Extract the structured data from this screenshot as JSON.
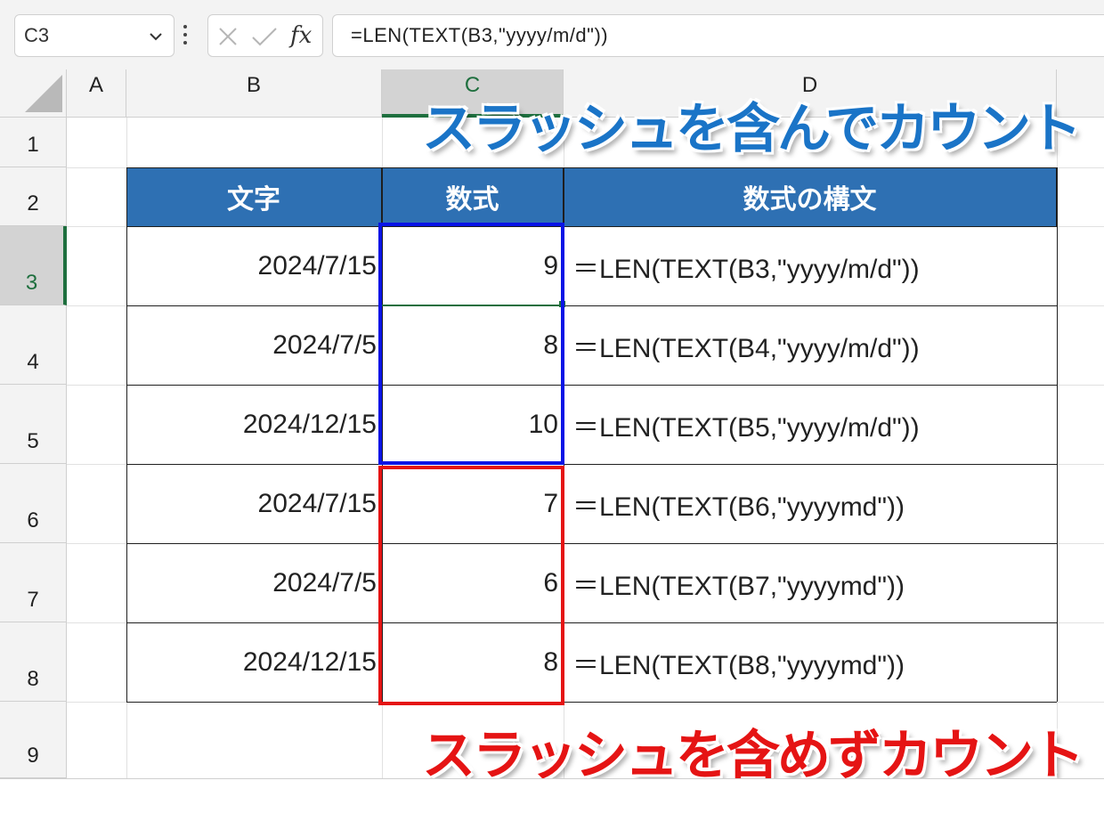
{
  "formula_bar": {
    "name_box": "C3",
    "fx_label": "fx",
    "formula": "=LEN(TEXT(B3,\"yyyy/m/d\"))"
  },
  "columns": [
    "A",
    "B",
    "C",
    "D"
  ],
  "rows": [
    "1",
    "2",
    "3",
    "4",
    "5",
    "6",
    "7",
    "8",
    "9"
  ],
  "table": {
    "headers": [
      "文字",
      "数式",
      "数式の構文"
    ],
    "rows": [
      {
        "text": "2024/7/15",
        "result": "9",
        "formula": "＝LEN(TEXT(B3,\"yyyy/m/d\"))"
      },
      {
        "text": "2024/7/5",
        "result": "8",
        "formula": "＝LEN(TEXT(B4,\"yyyy/m/d\"))"
      },
      {
        "text": "2024/12/15",
        "result": "10",
        "formula": "＝LEN(TEXT(B5,\"yyyy/m/d\"))"
      },
      {
        "text": "2024/7/15",
        "result": "7",
        "formula": "＝LEN(TEXT(B6,\"yyyymd\"))"
      },
      {
        "text": "2024/7/5",
        "result": "6",
        "formula": "＝LEN(TEXT(B7,\"yyyymd\"))"
      },
      {
        "text": "2024/12/15",
        "result": "8",
        "formula": "＝LEN(TEXT(B8,\"yyyymd\"))"
      }
    ]
  },
  "callouts": {
    "with_slash": "スラッシュを含んでカウント",
    "without_slash": "スラッシュを含めずカウント"
  },
  "colors": {
    "header_fill": "#2e70b3",
    "selection": "#1e6f3e",
    "blue_box": "#0a14e6",
    "red_box": "#e51414",
    "callout_blue": "#1a74c7",
    "callout_red": "#e51414"
  }
}
